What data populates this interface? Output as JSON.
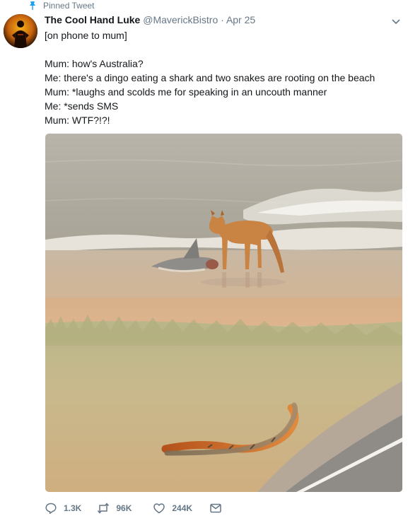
{
  "pinned_label": "Pinned Tweet",
  "author": {
    "name": "The Cool Hand Luke",
    "handle": "@MaverickBistro",
    "separator": "·",
    "date": "Apr 25"
  },
  "tweet_lines": [
    "[on phone to mum]",
    "",
    "Mum: how's Australia?",
    "Me: there's a dingo eating a shark and two snakes are rooting on the beach",
    "Mum: *laughs and scolds me for speaking in an uncouth manner",
    "Me: *sends SMS",
    "Mum: WTF?!?!"
  ],
  "stats": {
    "replies": "1.3K",
    "retweets": "96K",
    "likes": "244K"
  },
  "colors": {
    "text": "#14171a",
    "muted": "#657786",
    "pin": "#1da1f2"
  },
  "icons": {
    "pin": "pin-icon",
    "caret": "chevron-down-icon",
    "reply": "reply-icon",
    "retweet": "retweet-icon",
    "like": "heart-icon",
    "dm": "envelope-icon"
  }
}
